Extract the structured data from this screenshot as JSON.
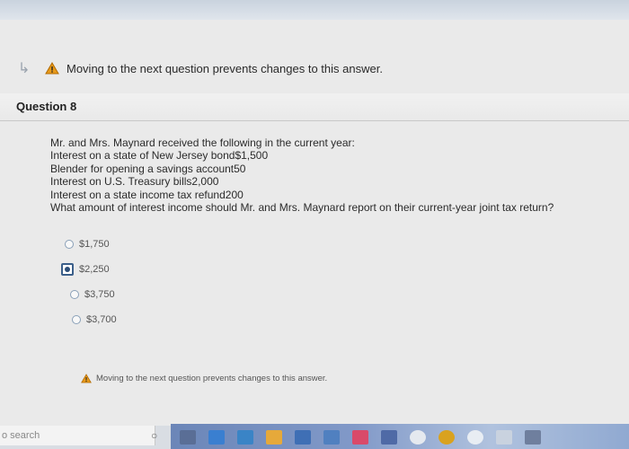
{
  "warning_top": "Moving to the next question prevents changes to this answer.",
  "question": {
    "title": "Question 8",
    "lines": [
      "Mr. and Mrs. Maynard received the following in the current year:",
      "Interest on a state of New Jersey bond$1,500",
      "Blender for opening a savings account50",
      "Interest on U.S. Treasury bills2,000",
      "Interest on a state income tax refund200",
      "What amount of interest income should Mr. and Mrs. Maynard report on their current-year joint tax return?"
    ],
    "options": [
      "$1,750",
      "$2,250",
      "$3,750",
      "$3,700"
    ],
    "selected_index": 1
  },
  "warning_bottom": "Moving to the next question prevents changes to this answer.",
  "taskbar": {
    "search_placeholder": "o search"
  },
  "icons": {
    "arrow": "return-arrow-icon",
    "warning": "warning-triangle-icon"
  },
  "colors": {
    "warning": "#e89a1a",
    "radio_selected": "#2d4e78"
  }
}
